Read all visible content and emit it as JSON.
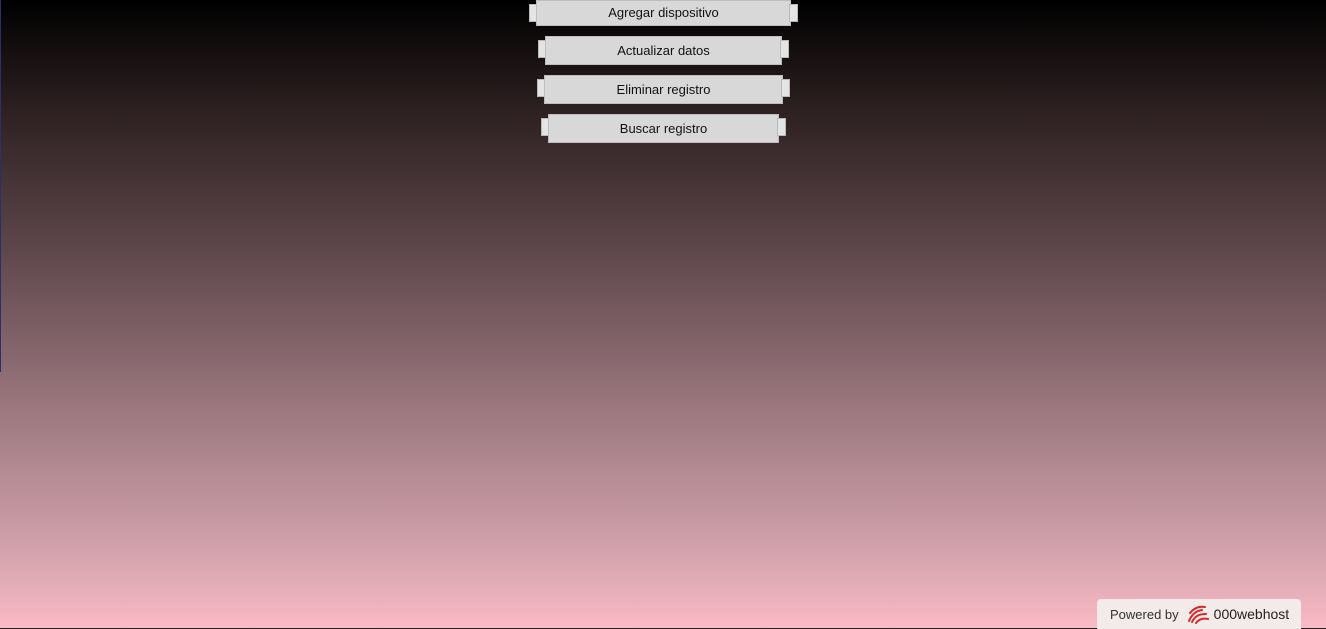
{
  "menu": {
    "buttons": [
      {
        "label": "Agregar dispositivo"
      },
      {
        "label": "Actualizar datos"
      },
      {
        "label": "Eliminar registro"
      },
      {
        "label": "Buscar registro"
      }
    ]
  },
  "footer_badge": {
    "powered_label": "Powered by",
    "brand_label": "000webhost",
    "logo_icon": "000webhost-logo-icon",
    "logo_color": "#d42a2a"
  }
}
